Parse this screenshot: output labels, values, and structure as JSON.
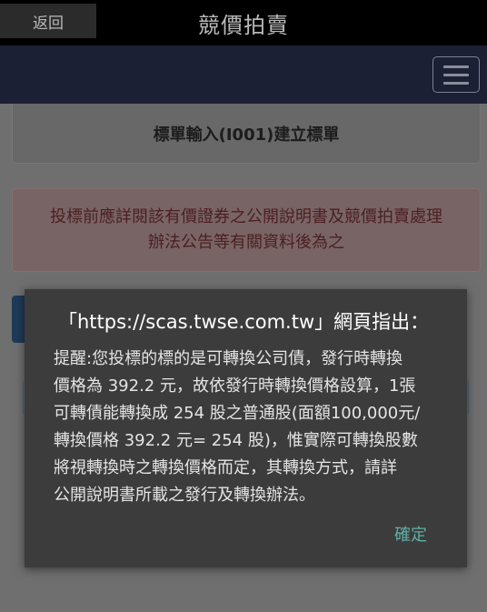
{
  "topbar": {
    "back_label": "返回",
    "title": "競價拍賣"
  },
  "card": {
    "title": "標單輸入(I001)建立標單"
  },
  "alert": {
    "line1": "投標前應詳閱該有價證券之公開說明書及競價拍賣處理",
    "line2": "辦法公告等有關資料後為之"
  },
  "dialog": {
    "title": "「https://scas.twse.com.tw」網頁指出：",
    "lines": [
      "提醒:您投標的標的是可轉換公司債，發行時轉換",
      "價格為 392.2 元，故依發行時轉換價格設算，1張",
      "可轉債能轉換成 254 股之普通股(面額100,000元/",
      "轉換價格 392.2 元= 254 股)，惟實際可轉換股數",
      "將視轉換時之轉換價格而定，其轉換方式，請詳",
      "公開說明書所載之發行及轉換辦法。"
    ],
    "ok_label": "確定"
  },
  "colors": {
    "navbar": "#1c2035",
    "dialog_bg": "#3c3c3c",
    "ok_button": "#5fb0a4",
    "alert_text": "#4a1f22"
  },
  "icons": {
    "menu": "hamburger-menu-icon"
  }
}
